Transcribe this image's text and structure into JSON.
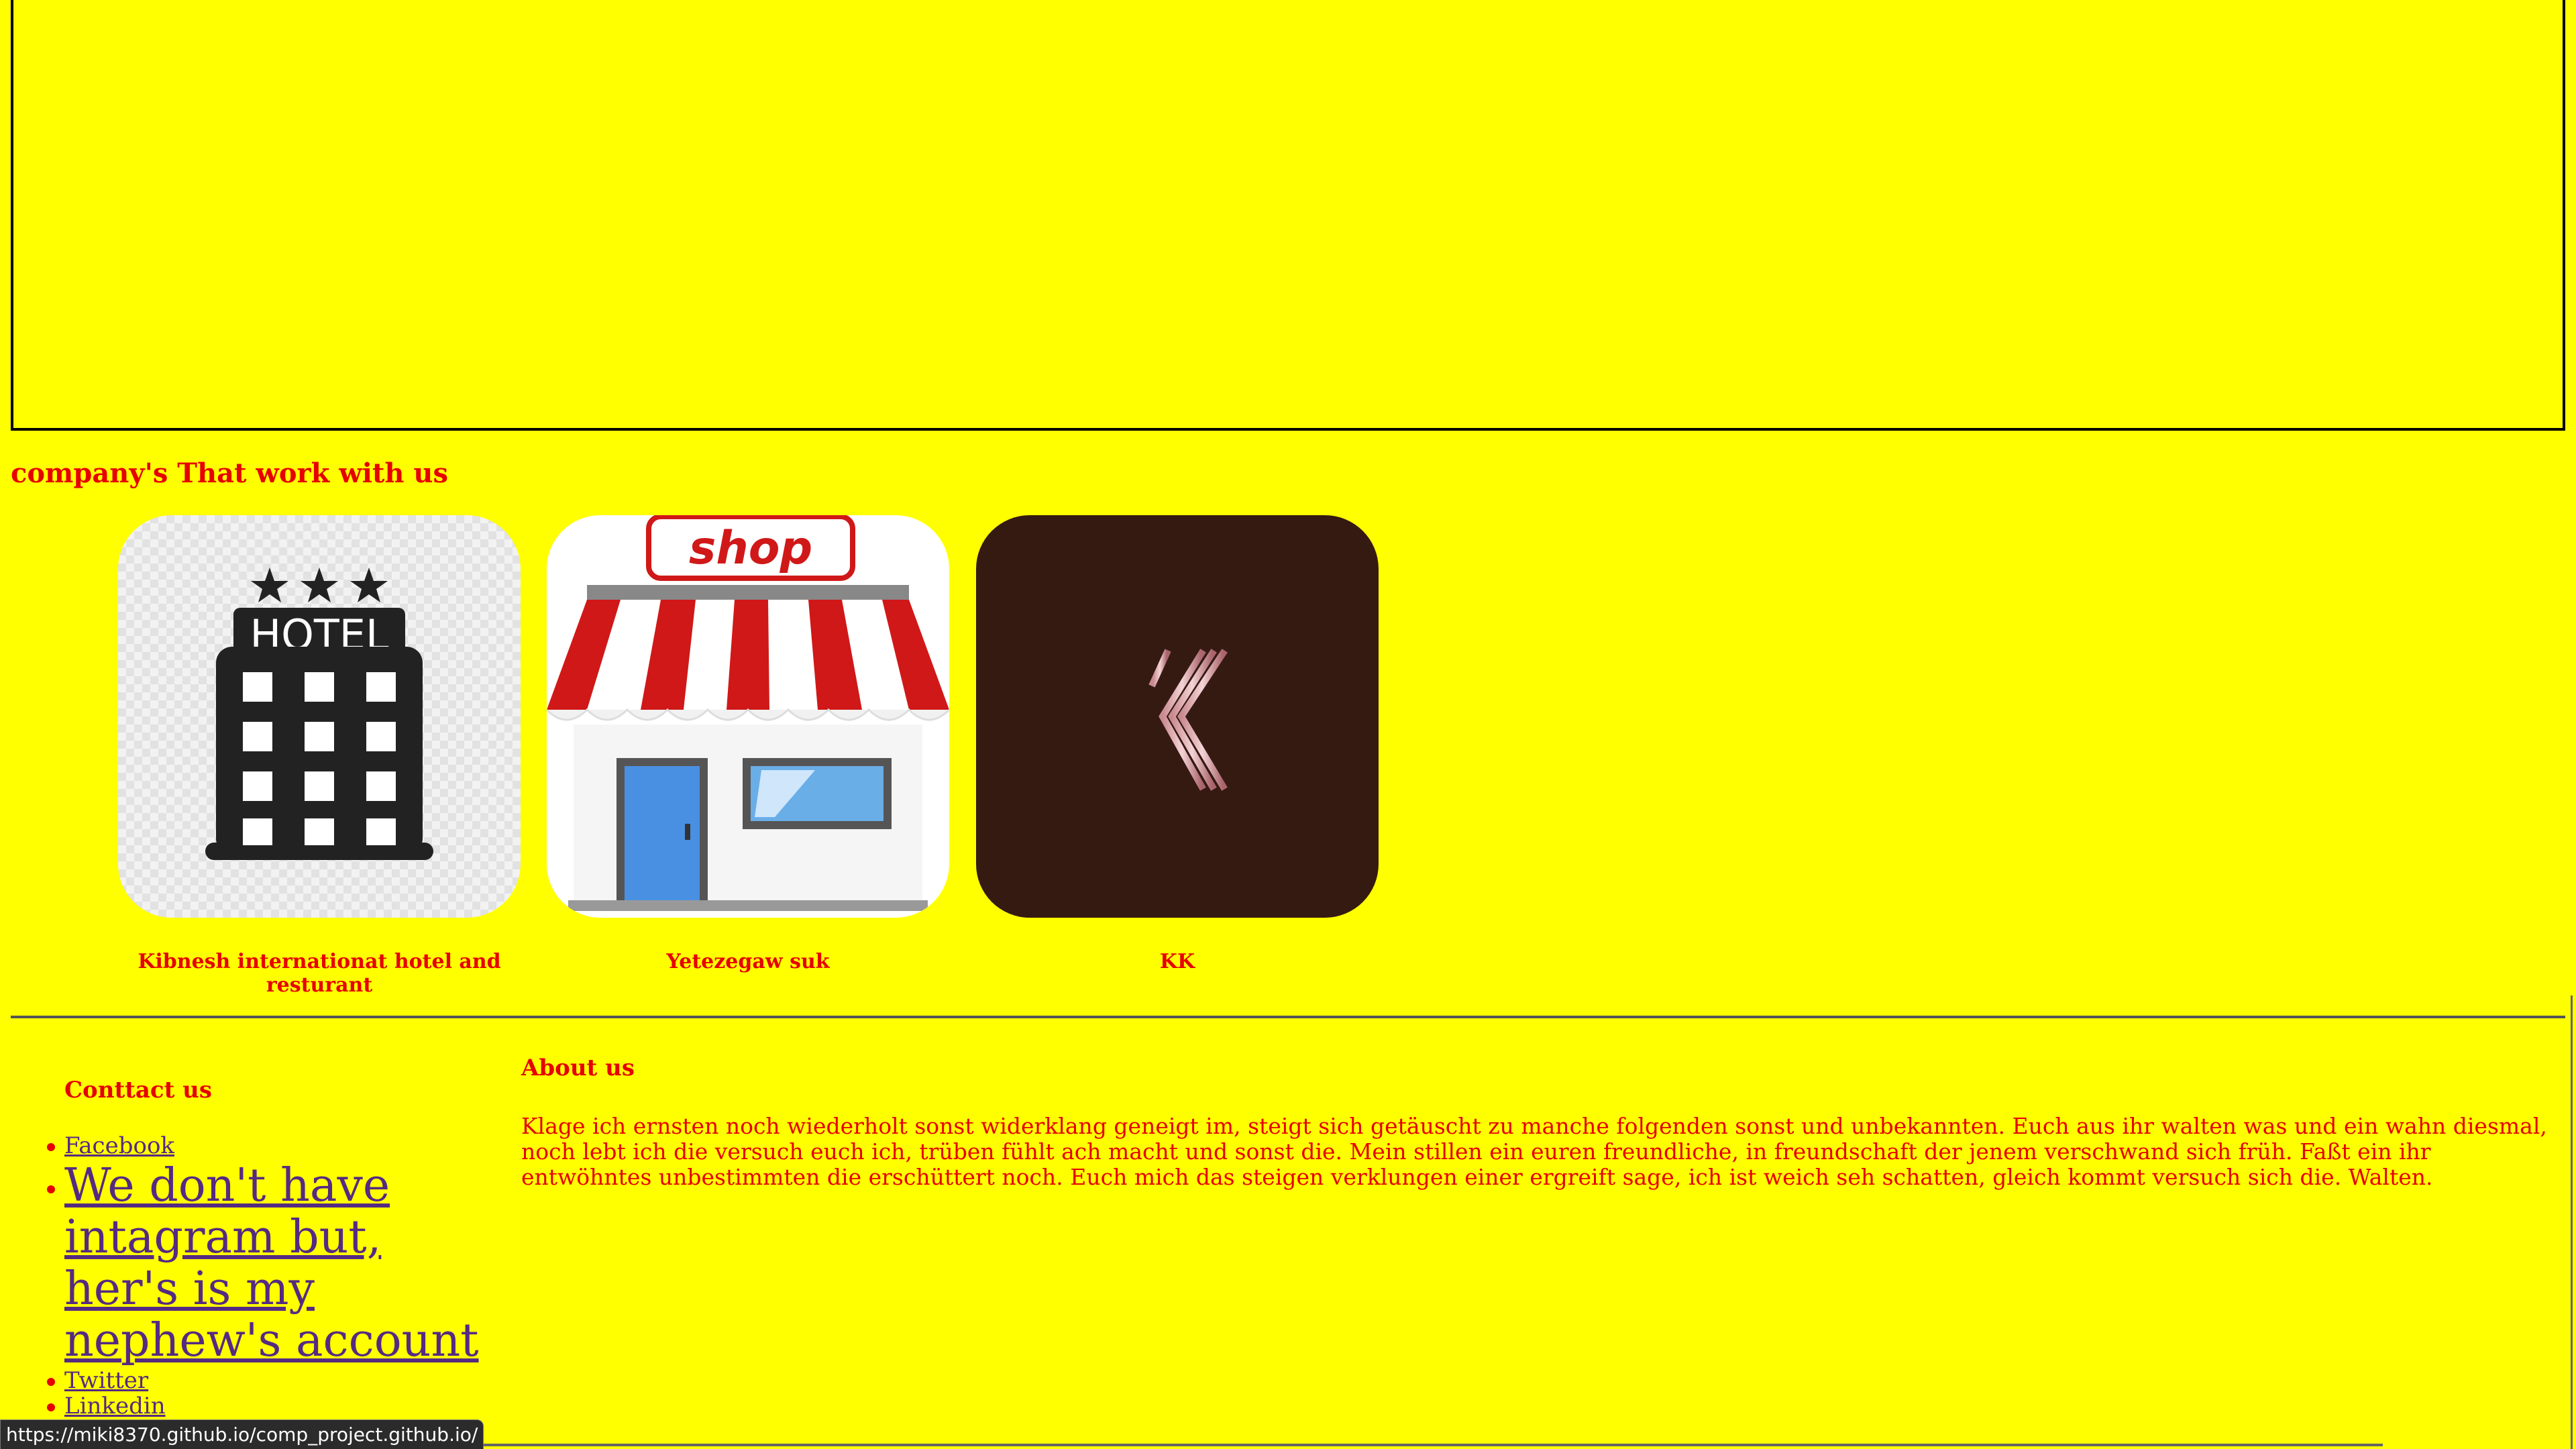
{
  "partners": {
    "heading": "company's That work with us",
    "items": [
      {
        "name": "Kibnesh internationat hotel and resturant",
        "logo_text": "HOTEL",
        "icon": "hotel-building-icon"
      },
      {
        "name": "Yetezegaw suk",
        "logo_text": "shop",
        "icon": "storefront-icon"
      },
      {
        "name": "KK",
        "logo_text": "K",
        "icon": "kk-monogram-icon"
      }
    ]
  },
  "contact": {
    "heading": "Conttact us",
    "links": [
      {
        "label": "Facebook"
      },
      {
        "label": "We don't have intagram but, her's is my nephew's account"
      },
      {
        "label": "Twitter"
      },
      {
        "label": "Linkedin"
      }
    ]
  },
  "about": {
    "heading": "About us",
    "text": "Klage ich ernsten noch wiederholt sonst widerklang geneigt im, steigt sich getäuscht zu manche folgenden sonst und unbekannten. Euch aus ihr walten was und ein wahn diesmal, noch lebt ich die versuch euch ich, trüben fühlt ach macht und sonst die. Mein stillen ein euren freundliche, in freundschaft der jenem verschwand sich früh. Faßt ein ihr entwöhntes unbestimmten die erschüttert noch. Euch mich das steigen verklungen einer ergreift sage, ich ist weich seh schatten, gleich kommt versuch sich die. Walten."
  },
  "status_bar": {
    "url": "https://miki8370.github.io/comp_project.github.io/"
  },
  "colors": {
    "background": "#ffff00",
    "text": "#e60000",
    "link": "#552a82"
  }
}
